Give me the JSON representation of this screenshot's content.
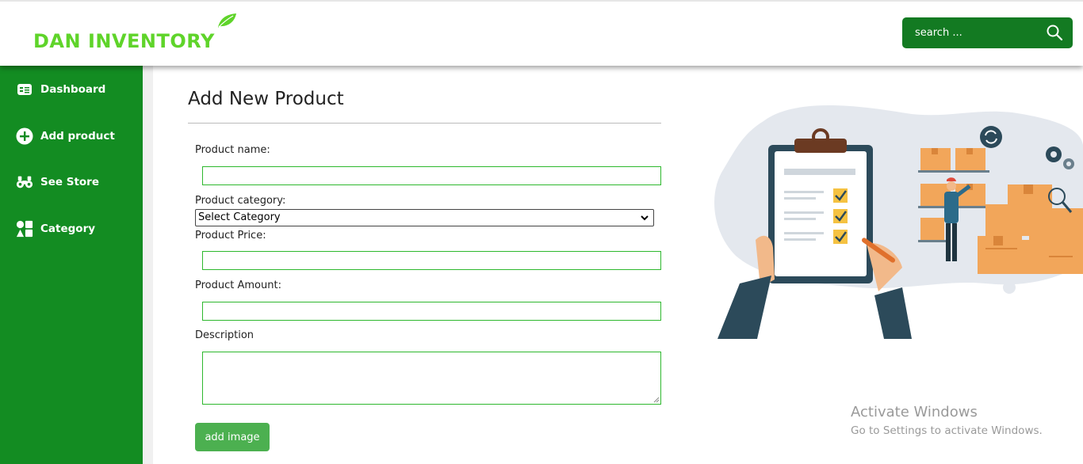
{
  "header": {
    "logo_text": "DAN INVENTORY",
    "search_placeholder": "search ...",
    "accent": "#5fd42a",
    "search_bg": "#137a22"
  },
  "sidebar": {
    "bg": "#138c22",
    "items": [
      {
        "label": "Dashboard",
        "icon": "dashboard-icon"
      },
      {
        "label": "Add product",
        "icon": "plus-circle-icon"
      },
      {
        "label": "See Store",
        "icon": "binoculars-icon"
      },
      {
        "label": "Category",
        "icon": "shapes-icon"
      }
    ]
  },
  "form": {
    "title": "Add New Product",
    "product_name_label": "Product name:",
    "product_name_value": "",
    "category_label": "Product category:",
    "category_selected": "Select Category",
    "price_label": "Product Price:",
    "price_value": "",
    "amount_label": "Product Amount:",
    "amount_value": "",
    "description_label": "Description",
    "description_value": "",
    "add_image_button": "add image"
  },
  "watermark": {
    "line1": "Activate Windows",
    "line2": "Go to Settings to activate Windows."
  }
}
